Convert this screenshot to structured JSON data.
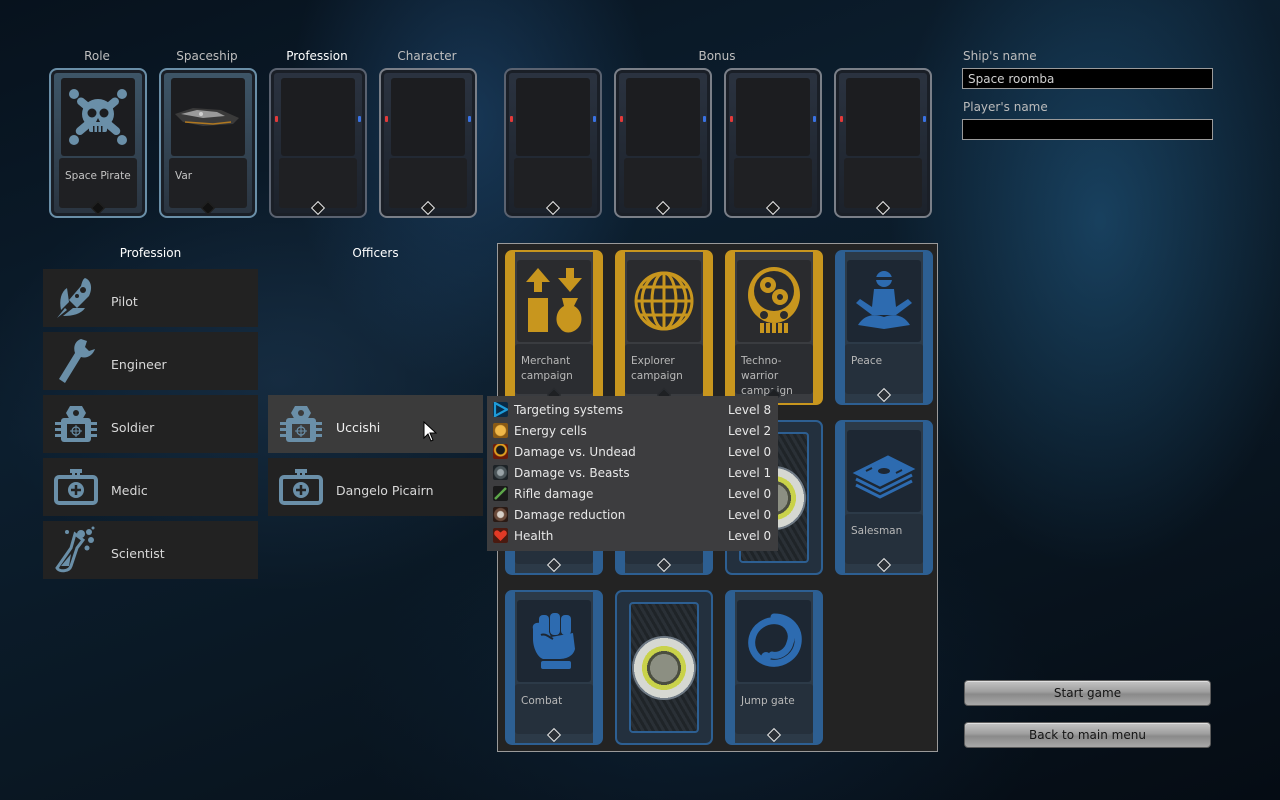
{
  "slots": {
    "headers": {
      "role": "Role",
      "spaceship": "Spaceship",
      "profession": "Profession",
      "character": "Character",
      "bonus": "Bonus"
    },
    "role": {
      "value": "Space Pirate",
      "icon": "skull-crossbones-icon"
    },
    "spaceship": {
      "value": "Var",
      "icon": "spaceship-icon"
    },
    "profession": {
      "value": ""
    },
    "character": {
      "value": ""
    },
    "bonus": [
      {
        "value": ""
      },
      {
        "value": ""
      },
      {
        "value": ""
      },
      {
        "value": ""
      }
    ]
  },
  "form": {
    "ship_name_label": "Ship's name",
    "ship_name_value": "Space roomba",
    "player_name_label": "Player's name",
    "player_name_value": ""
  },
  "profession_list": {
    "title": "Profession",
    "items": [
      {
        "label": "Pilot",
        "icon": "rocket-icon"
      },
      {
        "label": "Engineer",
        "icon": "wrench-icon"
      },
      {
        "label": "Soldier",
        "icon": "armor-icon"
      },
      {
        "label": "Medic",
        "icon": "medkit-icon"
      },
      {
        "label": "Scientist",
        "icon": "flask-icon"
      }
    ]
  },
  "officers_list": {
    "title": "Officers",
    "items": [
      {
        "label": "Uccishi",
        "icon": "armor-icon",
        "hovered": true
      },
      {
        "label": "Dangelo Picairn",
        "icon": "medkit-icon"
      }
    ]
  },
  "cards": [
    {
      "label": "Merchant campaign",
      "lines": [
        "Merchant",
        "campaign"
      ],
      "style": "gold",
      "icon": "trade-arrows-icon"
    },
    {
      "label": "Explorer campaign",
      "lines": [
        "Explorer",
        "campaign"
      ],
      "style": "gold",
      "icon": "globe-icon"
    },
    {
      "label": "Techno-warrior campaign",
      "lines": [
        "Techno-",
        "warrior",
        "campaign"
      ],
      "style": "gold",
      "icon": "gear-robot-icon"
    },
    {
      "label": "Peace",
      "lines": [
        "Peace"
      ],
      "style": "blue",
      "icon": "meditation-icon"
    },
    {
      "label": "",
      "style": "blue-hidden"
    },
    {
      "label": "",
      "style": "blue-hidden"
    },
    {
      "label": "",
      "style": "back"
    },
    {
      "label": "Salesman",
      "lines": [
        "Salesman"
      ],
      "style": "blue",
      "icon": "money-stack-icon"
    },
    {
      "label": "Combat",
      "lines": [
        "Combat"
      ],
      "style": "blue",
      "icon": "fist-icon"
    },
    {
      "label": "",
      "style": "back"
    },
    {
      "label": "Jump gate",
      "lines": [
        "Jump gate"
      ],
      "style": "blue",
      "icon": "portal-ring-icon"
    }
  ],
  "tooltip": {
    "rows": [
      {
        "name": "Targeting systems",
        "level": "Level 8",
        "icon": "targeting-icon",
        "color": "#1e9bd8"
      },
      {
        "name": "Energy cells",
        "level": "Level 2",
        "icon": "battery-icon",
        "color": "#d49a2a"
      },
      {
        "name": "Damage vs. Undead",
        "level": "Level 0",
        "icon": "undead-icon",
        "color": "#c9801a"
      },
      {
        "name": "Damage vs. Beasts",
        "level": "Level 1",
        "icon": "beast-icon",
        "color": "#6f7a80"
      },
      {
        "name": "Rifle damage",
        "level": "Level 0",
        "icon": "rifle-icon",
        "color": "#5da64a"
      },
      {
        "name": "Damage reduction",
        "level": "Level 0",
        "icon": "shield-icon",
        "color": "#8c6a5a"
      },
      {
        "name": "Health",
        "level": "Level 0",
        "icon": "heart-icon",
        "color": "#e23a26"
      }
    ]
  },
  "buttons": {
    "start": "Start game",
    "back": "Back to main menu"
  },
  "colors": {
    "gold_card": "#c8961e",
    "blue_card": "#2d5f92",
    "icon_steel": "#6a8fa8",
    "row_bg": "#222222",
    "row_hover": "#3b3b3b"
  }
}
